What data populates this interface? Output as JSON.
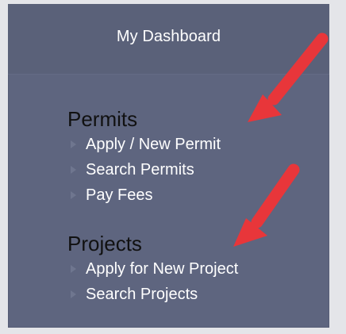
{
  "header": {
    "title": "My Dashboard"
  },
  "sections": [
    {
      "title": "Permits",
      "items": [
        "Apply / New Permit",
        "Search Permits",
        "Pay Fees"
      ]
    },
    {
      "title": "Projects",
      "items": [
        "Apply for New Project",
        "Search Projects"
      ]
    }
  ],
  "colors": {
    "panel": "#5e657f",
    "header": "#5a6179",
    "link_text": "#ffffff",
    "section_text": "#111111",
    "annotation_arrow": "#e8363a"
  },
  "icons": {
    "bullet": "triangle-right-icon",
    "annotation": "red-arrow-icon"
  }
}
